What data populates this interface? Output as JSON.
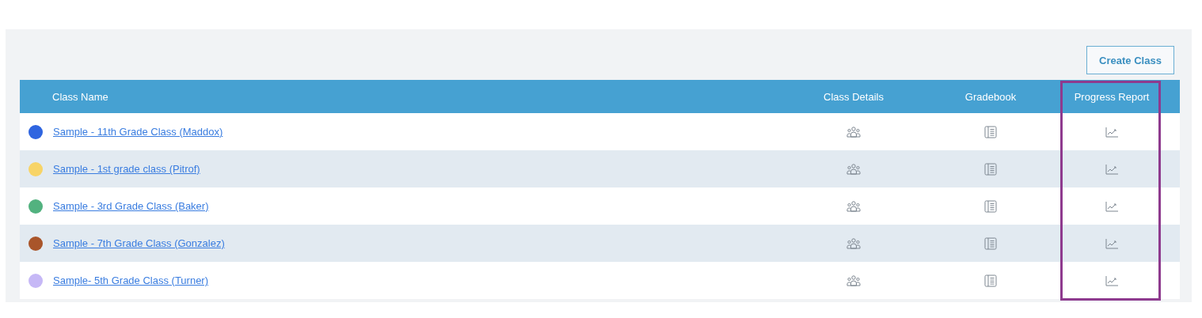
{
  "create_button": "Create Class",
  "columns": [
    {
      "label": "Class Name",
      "highlighted": false
    },
    {
      "label": "Class Details",
      "highlighted": false
    },
    {
      "label": "Gradebook",
      "highlighted": false
    },
    {
      "label": "Progress Report",
      "highlighted": true
    }
  ],
  "rows": [
    {
      "name": "Sample - 11th Grade Class (Maddox)",
      "color": "#2f65e0"
    },
    {
      "name": "Sample - 1st grade class (Pitrof)",
      "color": "#f7d467"
    },
    {
      "name": "Sample - 3rd Grade Class (Baker)",
      "color": "#52b27f"
    },
    {
      "name": "Sample - 7th Grade Class (Gonzalez)",
      "color": "#a9552a"
    },
    {
      "name": "Sample- 5th Grade Class (Turner)",
      "color": "#c6b8f6"
    }
  ]
}
